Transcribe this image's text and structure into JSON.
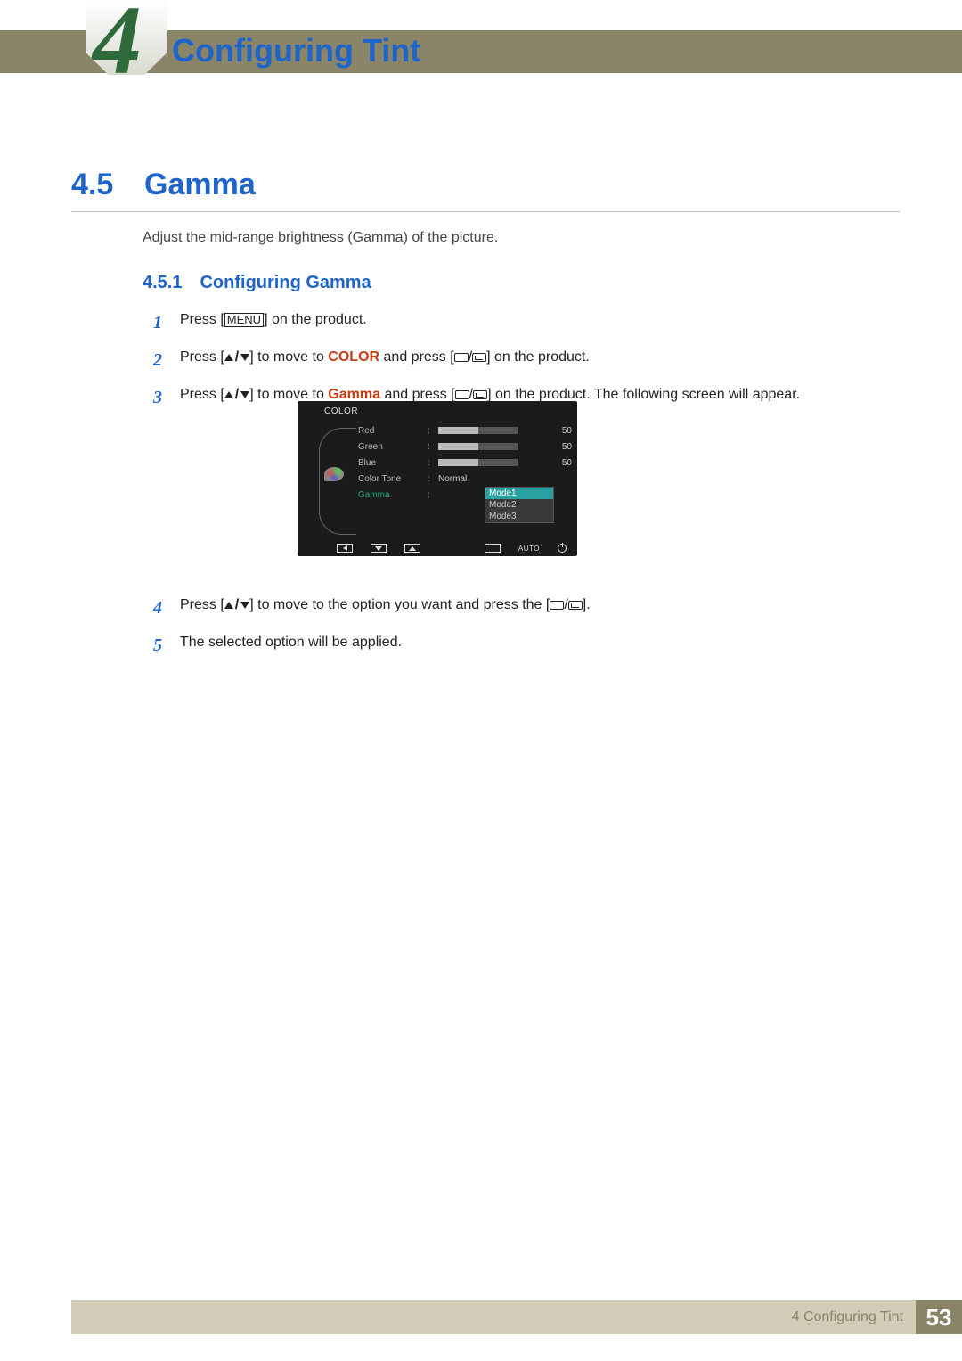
{
  "header": {
    "chapter_number_bg": "4",
    "chapter_title": "Configuring Tint"
  },
  "section": {
    "number": "4.5",
    "title": "Gamma",
    "intro": "Adjust the mid-range brightness (Gamma) of the picture."
  },
  "subsection": {
    "number": "4.5.1",
    "title": "Configuring Gamma"
  },
  "steps": [
    {
      "n": "1",
      "pre": "Press [",
      "menu": "MENU",
      "post": "] on the product."
    },
    {
      "n": "2",
      "pre": "Press [",
      "mid1": "] to move to ",
      "accent": "COLOR",
      "mid2": " and press [",
      "post": "] on the product."
    },
    {
      "n": "3",
      "pre": "Press [",
      "mid1": "] to move to ",
      "accent": "Gamma",
      "mid2": " and press [",
      "post": "] on the product. The following screen will appear."
    },
    {
      "n": "4",
      "pre": "Press [",
      "mid1": "] to move to the option you want and press the [",
      "post": "]."
    },
    {
      "n": "5",
      "text": "The selected option will be applied."
    }
  ],
  "osd": {
    "panel_title": "COLOR",
    "rows": [
      {
        "label": "Red",
        "type": "slider",
        "value": "50",
        "fill_pct": 50
      },
      {
        "label": "Green",
        "type": "slider",
        "value": "50",
        "fill_pct": 50
      },
      {
        "label": "Blue",
        "type": "slider",
        "value": "50",
        "fill_pct": 50
      },
      {
        "label": "Color Tone",
        "type": "text",
        "text": "Normal"
      },
      {
        "label": "Gamma",
        "type": "select",
        "selected": true
      }
    ],
    "dropdown": [
      "Mode1",
      "Mode2",
      "Mode3"
    ],
    "dropdown_selected_index": 0,
    "auto_label": "AUTO"
  },
  "footer": {
    "chapter_ref": "4 Configuring Tint",
    "page": "53"
  }
}
